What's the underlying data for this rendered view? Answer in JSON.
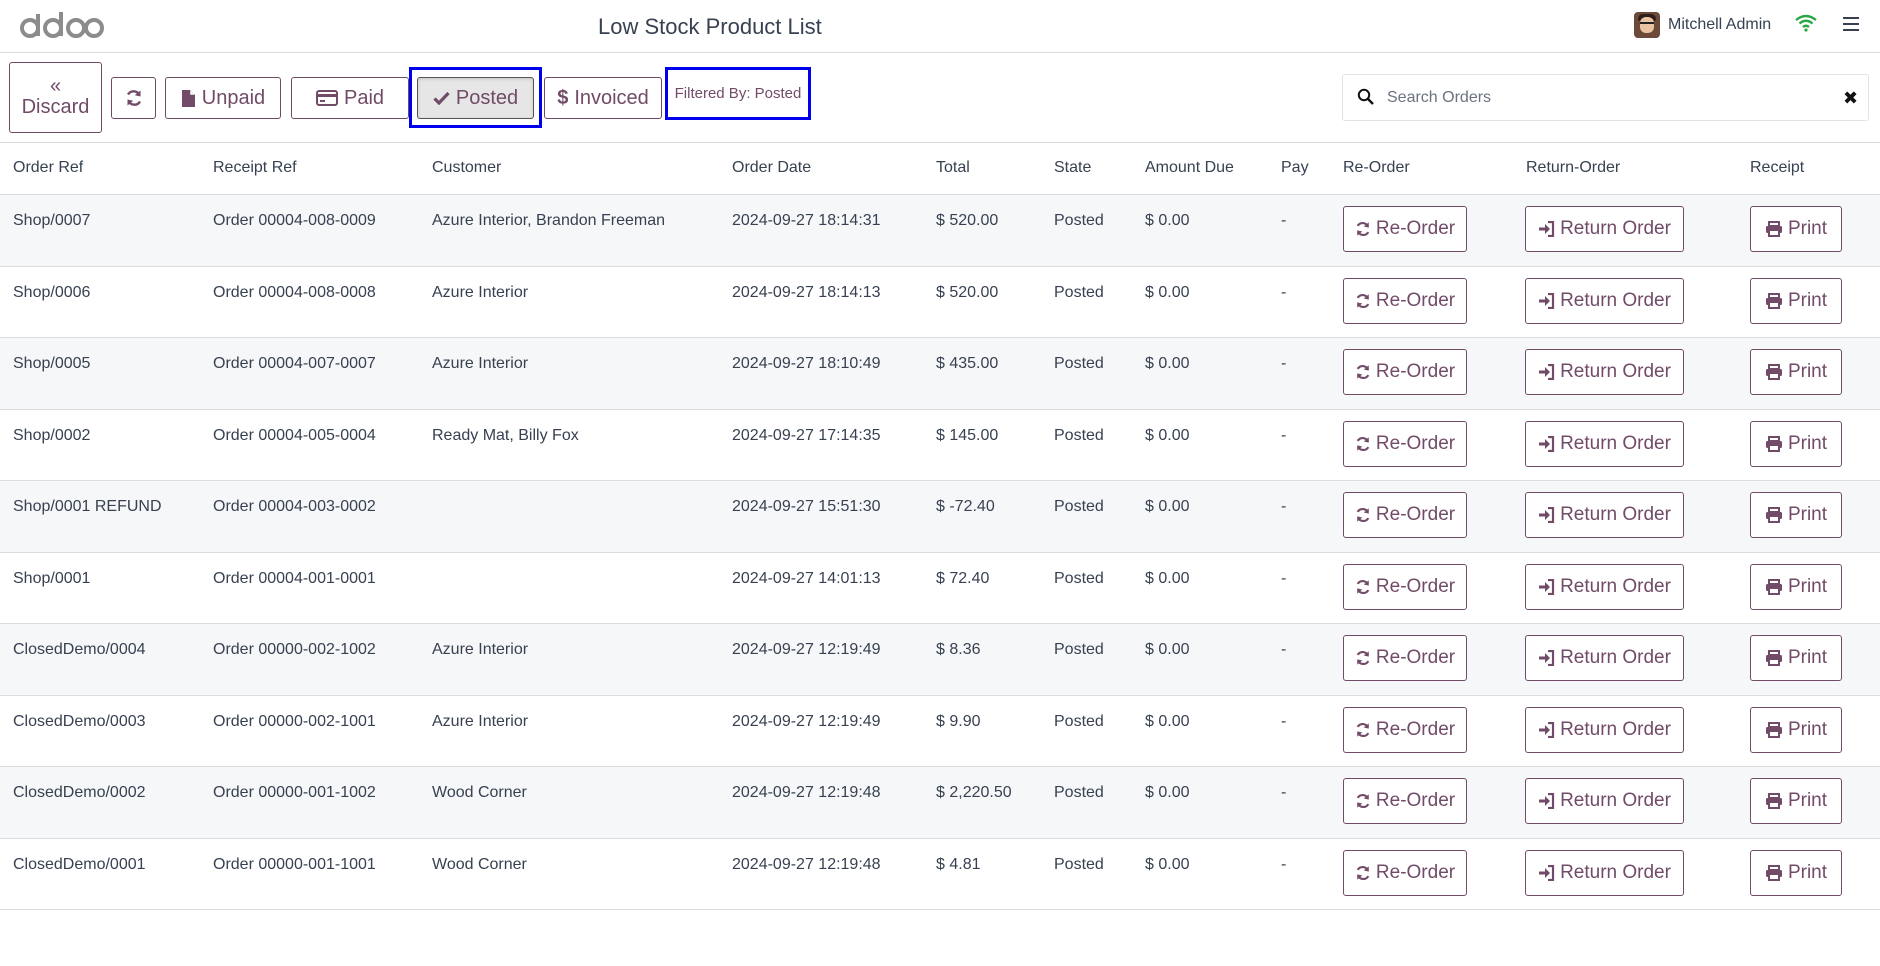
{
  "header": {
    "logo_text": "odoo",
    "title": "Low Stock Product List",
    "user_name": "Mitchell Admin",
    "icons": {
      "wifi": "wifi-icon",
      "menu": "hamburger-menu-icon"
    },
    "colors": {
      "accent": "#714B67",
      "wifi": "#28a745",
      "highlight": "#0000ee"
    }
  },
  "toolbar": {
    "discard_label": "Discard",
    "unpaid_label": "Unpaid",
    "paid_label": "Paid",
    "posted_label": "Posted",
    "invoiced_label": "Invoiced",
    "filter_text": "Filtered By: Posted",
    "search_placeholder": "Search Orders"
  },
  "table": {
    "columns": [
      "Order Ref",
      "Receipt Ref",
      "Customer",
      "Order Date",
      "Total",
      "State",
      "Amount Due",
      "Pay",
      "Re-Order",
      "Return-Order",
      "Receipt"
    ],
    "reorder_label": "Re-Order",
    "return_label": "Return Order",
    "print_label": "Print",
    "rows": [
      {
        "order_ref": "Shop/0007",
        "receipt_ref": "Order 00004-008-0009",
        "customer": "Azure Interior, Brandon Freeman",
        "date": "2024-09-27 18:14:31",
        "total": "$ 520.00",
        "state": "Posted",
        "amount_due": "$ 0.00",
        "pay": "-"
      },
      {
        "order_ref": "Shop/0006",
        "receipt_ref": "Order 00004-008-0008",
        "customer": "Azure Interior",
        "date": "2024-09-27 18:14:13",
        "total": "$ 520.00",
        "state": "Posted",
        "amount_due": "$ 0.00",
        "pay": "-"
      },
      {
        "order_ref": "Shop/0005",
        "receipt_ref": "Order 00004-007-0007",
        "customer": "Azure Interior",
        "date": "2024-09-27 18:10:49",
        "total": "$ 435.00",
        "state": "Posted",
        "amount_due": "$ 0.00",
        "pay": "-"
      },
      {
        "order_ref": "Shop/0002",
        "receipt_ref": "Order 00004-005-0004",
        "customer": "Ready Mat, Billy Fox",
        "date": "2024-09-27 17:14:35",
        "total": "$ 145.00",
        "state": "Posted",
        "amount_due": "$ 0.00",
        "pay": "-"
      },
      {
        "order_ref": "Shop/0001 REFUND",
        "receipt_ref": "Order 00004-003-0002",
        "customer": "",
        "date": "2024-09-27 15:51:30",
        "total": "$ -72.40",
        "state": "Posted",
        "amount_due": "$ 0.00",
        "pay": "-"
      },
      {
        "order_ref": "Shop/0001",
        "receipt_ref": "Order 00004-001-0001",
        "customer": "",
        "date": "2024-09-27 14:01:13",
        "total": "$ 72.40",
        "state": "Posted",
        "amount_due": "$ 0.00",
        "pay": "-"
      },
      {
        "order_ref": "ClosedDemo/0004",
        "receipt_ref": "Order 00000-002-1002",
        "customer": "Azure Interior",
        "date": "2024-09-27 12:19:49",
        "total": "$ 8.36",
        "state": "Posted",
        "amount_due": "$ 0.00",
        "pay": "-"
      },
      {
        "order_ref": "ClosedDemo/0003",
        "receipt_ref": "Order 00000-002-1001",
        "customer": "Azure Interior",
        "date": "2024-09-27 12:19:49",
        "total": "$ 9.90",
        "state": "Posted",
        "amount_due": "$ 0.00",
        "pay": "-"
      },
      {
        "order_ref": "ClosedDemo/0002",
        "receipt_ref": "Order 00000-001-1002",
        "customer": "Wood Corner",
        "date": "2024-09-27 12:19:48",
        "total": "$ 2,220.50",
        "state": "Posted",
        "amount_due": "$ 0.00",
        "pay": "-"
      },
      {
        "order_ref": "ClosedDemo/0001",
        "receipt_ref": "Order 00000-001-1001",
        "customer": "Wood Corner",
        "date": "2024-09-27 12:19:48",
        "total": "$ 4.81",
        "state": "Posted",
        "amount_due": "$ 0.00",
        "pay": "-"
      }
    ]
  }
}
